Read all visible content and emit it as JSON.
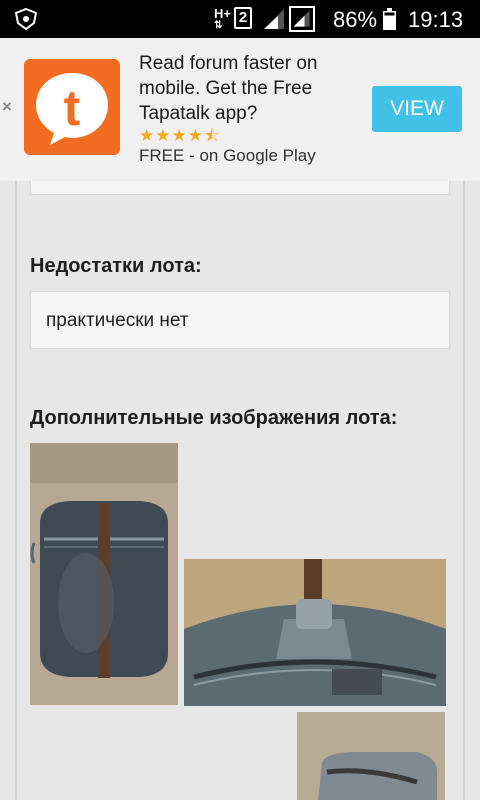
{
  "status_bar": {
    "network": "H+",
    "sim": "2",
    "battery": "86%",
    "time": "19:13"
  },
  "ad": {
    "title": "Read forum faster on mobile. Get the Free Tapatalk app?",
    "rating_stars": 4.5,
    "stars_text": "★★★★⯪",
    "subtitle": "FREE - on Google Play",
    "button": "VIEW",
    "close": "×",
    "logo_letter": "t",
    "brand_color": "#f26c22",
    "button_color": "#3fc2e6"
  },
  "lot": {
    "defects_title": "Недостатки лота:",
    "defects_text": "практически нет",
    "images_title": "Дополнительные изображения лота:"
  },
  "images": [
    {
      "name": "mess-kit-front-photo"
    },
    {
      "name": "mess-kit-lid-closeup-photo"
    },
    {
      "name": "mess-kit-third-photo"
    }
  ]
}
